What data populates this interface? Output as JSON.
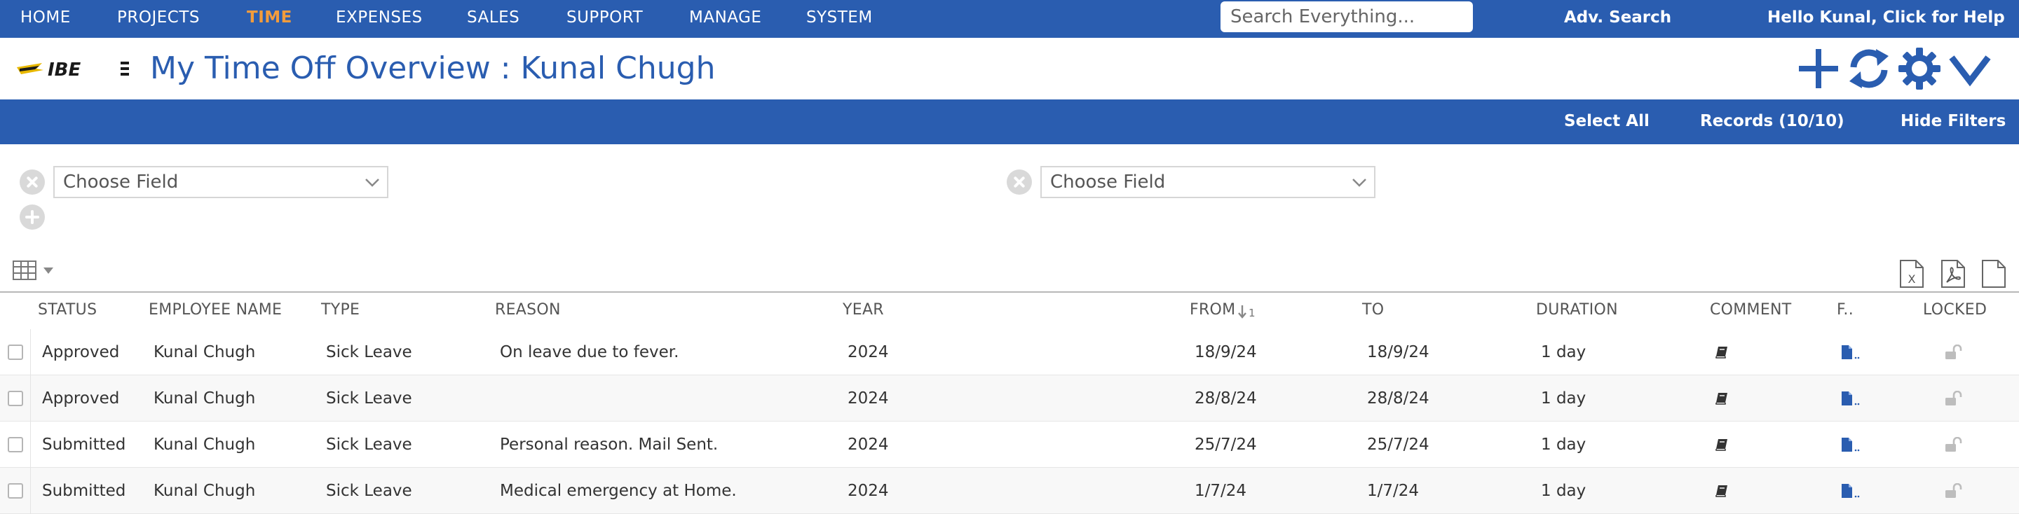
{
  "nav": {
    "items": [
      "HOME",
      "PROJECTS",
      "TIME",
      "EXPENSES",
      "SALES",
      "SUPPORT",
      "MANAGE",
      "SYSTEM"
    ],
    "active": "TIME",
    "search_placeholder": "Search Everything...",
    "adv_search": "Adv. Search",
    "greeting": "Hello Kunal, Click for Help"
  },
  "header": {
    "title": "My Time Off Overview : Kunal Chugh",
    "logo_text": "IBE"
  },
  "toolbar": {
    "select_all": "Select All",
    "records": "Records (10/10)",
    "hide_filters": "Hide Filters"
  },
  "filters": {
    "field1_placeholder": "Choose Field",
    "field2_placeholder": "Choose Field"
  },
  "table": {
    "headers": {
      "status": "STATUS",
      "employee": "EMPLOYEE NAME",
      "type": "TYPE",
      "reason": "REASON",
      "year": "YEAR",
      "from": "FROM",
      "sort_indicator": "1",
      "to": "TO",
      "duration": "DURATION",
      "comment": "COMMENT",
      "files": "F..",
      "locked": "LOCKED"
    },
    "rows": [
      {
        "status": "Approved",
        "employee": "Kunal Chugh",
        "type": "Sick Leave",
        "reason": "On leave due to fever.",
        "year": "2024",
        "from": "18/9/24",
        "to": "18/9/24",
        "duration": "1 day"
      },
      {
        "status": "Approved",
        "employee": "Kunal Chugh",
        "type": "Sick Leave",
        "reason": "",
        "year": "2024",
        "from": "28/8/24",
        "to": "28/8/24",
        "duration": "1 day"
      },
      {
        "status": "Submitted",
        "employee": "Kunal Chugh",
        "type": "Sick Leave",
        "reason": "Personal reason. Mail Sent.",
        "year": "2024",
        "from": "25/7/24",
        "to": "25/7/24",
        "duration": "1 day"
      },
      {
        "status": "Submitted",
        "employee": "Kunal Chugh",
        "type": "Sick Leave",
        "reason": "Medical emergency at Home.",
        "year": "2024",
        "from": "1/7/24",
        "to": "1/7/24",
        "duration": "1 day"
      }
    ]
  },
  "colors": {
    "brand_blue": "#2a5db0",
    "active_nav": "#f39c3c",
    "file_icon": "#2a5db0",
    "muted_icon": "#bdbdbd"
  }
}
